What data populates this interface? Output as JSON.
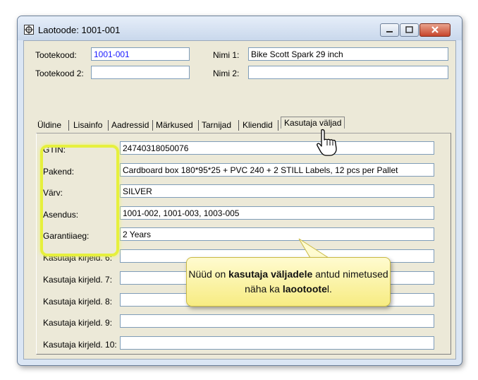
{
  "window": {
    "title": "Laotoode: 1001-001"
  },
  "header": {
    "tootekood_label": "Tootekood:",
    "tootekood_value": "1001-001",
    "tootekood2_label": "Tootekood 2:",
    "tootekood2_value": "",
    "nimi1_label": "Nimi 1:",
    "nimi1_value": "Bike Scott Spark 29 inch",
    "nimi2_label": "Nimi 2:",
    "nimi2_value": ""
  },
  "tabs": [
    "Üldine",
    "Lisainfo",
    "Aadressid",
    "Märkused",
    "Tarnijad",
    "Kliendid",
    "Kasutaja väljad"
  ],
  "active_tab": "Kasutaja väljad",
  "fields": [
    {
      "label": "GTIN:",
      "value": "24740318050076"
    },
    {
      "label": "Pakend:",
      "value": "Cardboard box 180*95*25 + PVC 240 + 2 STILL Labels, 12 pcs per Pallet"
    },
    {
      "label": "Värv:",
      "value": "SILVER"
    },
    {
      "label": "Asendus:",
      "value": "1001-002, 1001-003, 1003-005"
    },
    {
      "label": "Garantiiaeg:",
      "value": "2 Years"
    },
    {
      "label": "Kasutaja kirjeld. 6:",
      "value": ""
    },
    {
      "label": "Kasutaja kirjeld. 7:",
      "value": ""
    },
    {
      "label": "Kasutaja kirjeld. 8:",
      "value": ""
    },
    {
      "label": "Kasutaja kirjeld. 9:",
      "value": ""
    },
    {
      "label": "Kasutaja kirjeld. 10:",
      "value": ""
    }
  ],
  "callout": {
    "part1": "Nüüd on ",
    "bold1": "kasutaja väljadele",
    "part2": " antud nimetused näha ka ",
    "bold2": "laootoote",
    "part3": "l."
  },
  "colors": {
    "highlight": "#e6f03d",
    "callout_bg": "#fff6a8",
    "code_value": "#1a1aff"
  }
}
